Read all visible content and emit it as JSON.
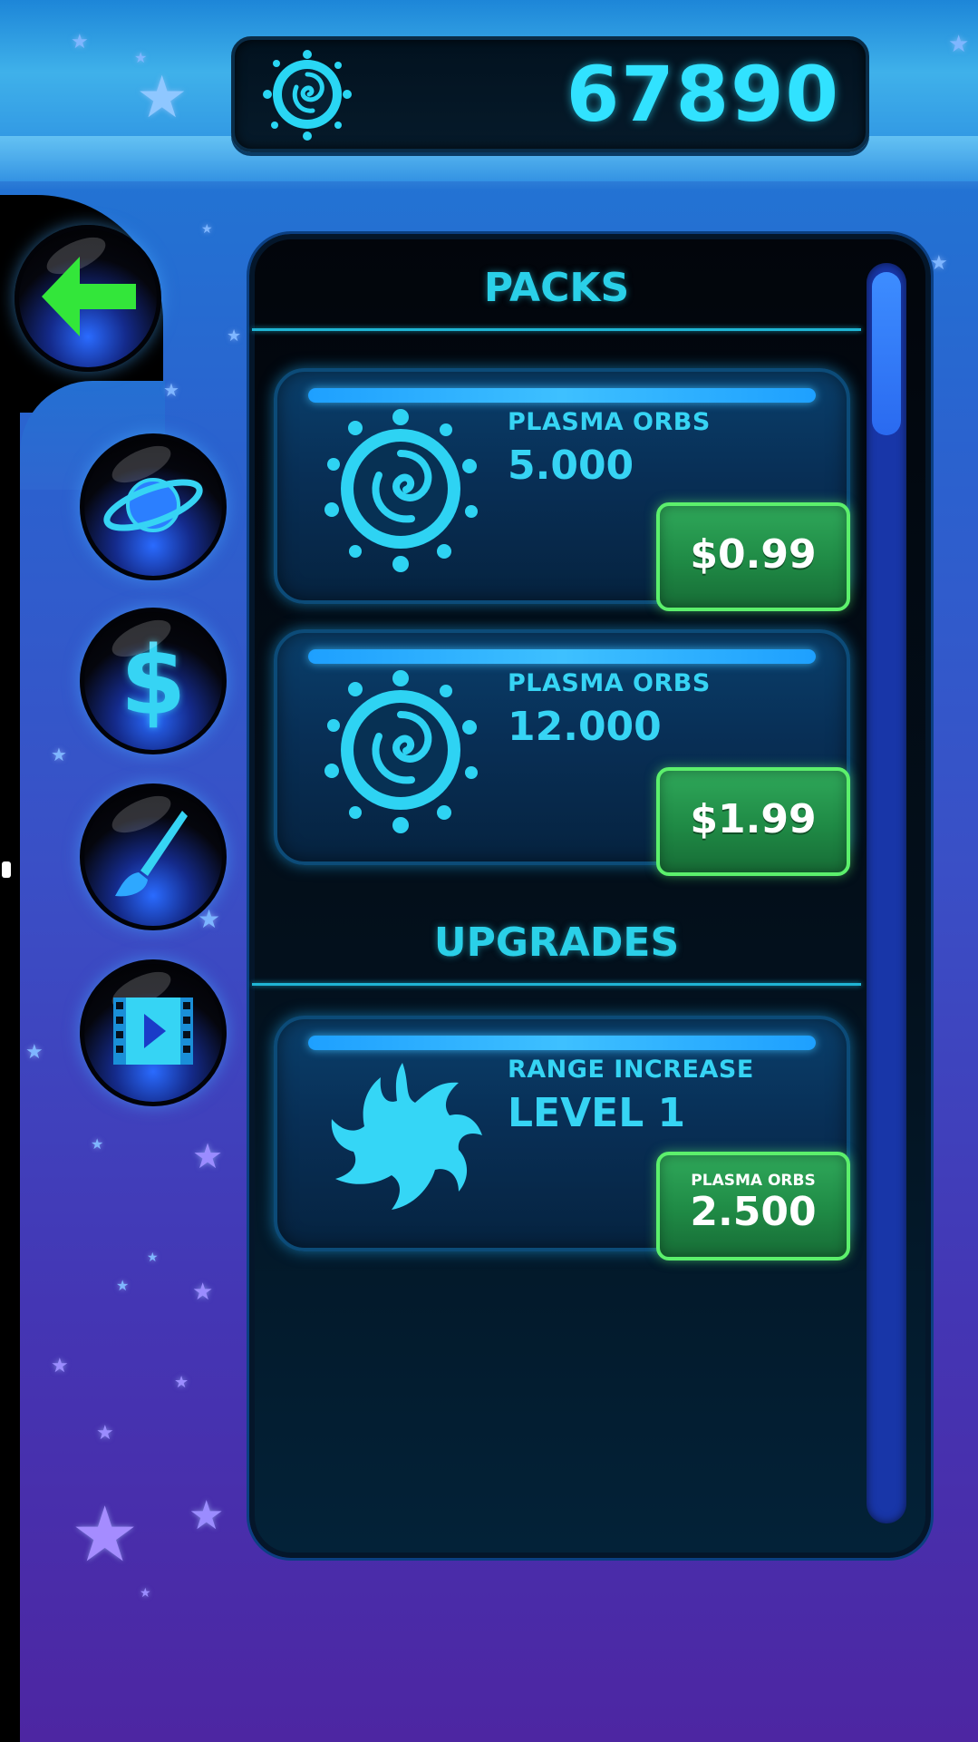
{
  "header": {
    "currency_icon": "plasma-orb-icon",
    "balance": "67890",
    "accent_color": "#31e2ff"
  },
  "side_menu": [
    {
      "icon": "back-arrow-icon"
    },
    {
      "icon": "planet-icon"
    },
    {
      "icon": "dollar-icon"
    },
    {
      "icon": "paintbrush-icon"
    },
    {
      "icon": "video-icon"
    }
  ],
  "sections": {
    "packs_title": "PACKS",
    "upgrades_title": "UPGRADES"
  },
  "packs": [
    {
      "label": "PLASMA ORBS",
      "amount": "5.000",
      "price": "$0.99",
      "icon": "plasma-orb-icon"
    },
    {
      "label": "PLASMA ORBS",
      "amount": "12.000",
      "price": "$1.99",
      "icon": "plasma-orb-icon"
    }
  ],
  "upgrades": [
    {
      "label": "RANGE INCREASE",
      "level": "LEVEL 1",
      "cost_label": "PLASMA ORBS",
      "cost": "2.500",
      "icon": "plasma-splash-icon"
    }
  ],
  "colors": {
    "button_green": "#2fa85a",
    "button_border": "#5cf06c",
    "text_cyan": "#36d4f4"
  }
}
